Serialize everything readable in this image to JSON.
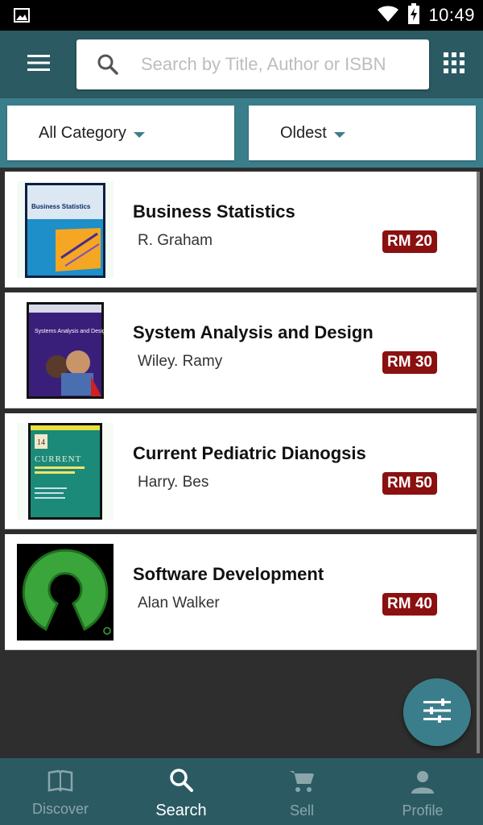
{
  "status_bar": {
    "time": "10:49",
    "icons": [
      "image-icon",
      "wifi-icon",
      "battery-charging-icon"
    ]
  },
  "app_bar": {
    "menu_icon": "menu-icon",
    "search_placeholder": "Search by Title, Author or ISBN",
    "search_value": "",
    "grid_icon": "grid-icon"
  },
  "filters": {
    "category": "All Category",
    "sort": "Oldest"
  },
  "books": [
    {
      "title": "Business Statistics",
      "author": "R. Graham",
      "price": "RM 20",
      "cover_text": "Business Statistics"
    },
    {
      "title": "System Analysis and Design",
      "author": "Wiley. Ramy",
      "price": "RM 30",
      "cover_text": "Systems Analysis and Design"
    },
    {
      "title": "Current Pediatric Dianogsis",
      "author": "Harry. Bes",
      "price": "RM 50",
      "cover_text": "CURRENT"
    },
    {
      "title": "Software Development",
      "author": "Alan Walker",
      "price": "RM 40",
      "cover_text": ""
    }
  ],
  "fab": {
    "icon": "filter-sliders-icon"
  },
  "bottom_nav": {
    "items": [
      {
        "label": "Discover",
        "icon": "book-icon",
        "active": false
      },
      {
        "label": "Search",
        "icon": "search-icon",
        "active": true
      },
      {
        "label": "Sell",
        "icon": "cart-icon",
        "active": false
      },
      {
        "label": "Profile",
        "icon": "person-icon",
        "active": false
      }
    ]
  },
  "colors": {
    "app_bar": "#2b5a63",
    "filter_bar": "#3b7e8b",
    "price_badge": "#8b1010",
    "background": "#2e2e2e"
  }
}
